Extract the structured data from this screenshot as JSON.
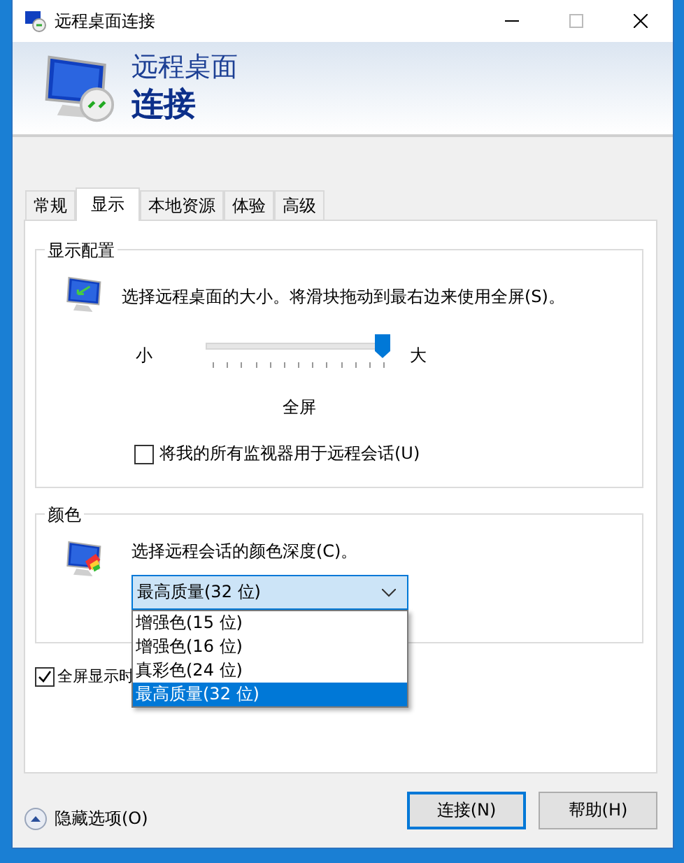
{
  "window": {
    "title": "远程桌面连接"
  },
  "banner": {
    "line_1": "远程桌面",
    "line_2": "连接"
  },
  "tabs": [
    {
      "label": "常规",
      "selected": false
    },
    {
      "label": "显示",
      "selected": true
    },
    {
      "label": "本地资源",
      "selected": false
    },
    {
      "label": "体验",
      "selected": false
    },
    {
      "label": "高级",
      "selected": false
    }
  ],
  "display_group": {
    "title": "显示配置",
    "description": "选择远程桌面的大小。将滑块拖动到最右边来使用全屏(S)。",
    "slider": {
      "min_label": "小",
      "max_label": "大",
      "level": 1
    },
    "size_reading": "全屏",
    "all_monitors": {
      "label": "将我的所有监视器用于远程会话(U)",
      "checked": false
    }
  },
  "color_group": {
    "title": "颜色",
    "description": "选择远程会话的颜色深度(C)。",
    "select": {
      "value": "最高质量(32 位)",
      "expanded": true,
      "options": [
        {
          "label": "增强色(15 位)",
          "selected": false
        },
        {
          "label": "增强色(16 位)",
          "selected": false
        },
        {
          "label": "真彩色(24 位)",
          "selected": false
        },
        {
          "label": "最高质量(32 位)",
          "selected": true
        }
      ]
    }
  },
  "fullscreen_bar": {
    "label": "全屏显示时",
    "checked": true
  },
  "hide_options": "隐藏选项(O)",
  "buttons": [
    {
      "label": "连接(N)",
      "default": true
    },
    {
      "label": "帮助(H)",
      "default": false
    }
  ]
}
